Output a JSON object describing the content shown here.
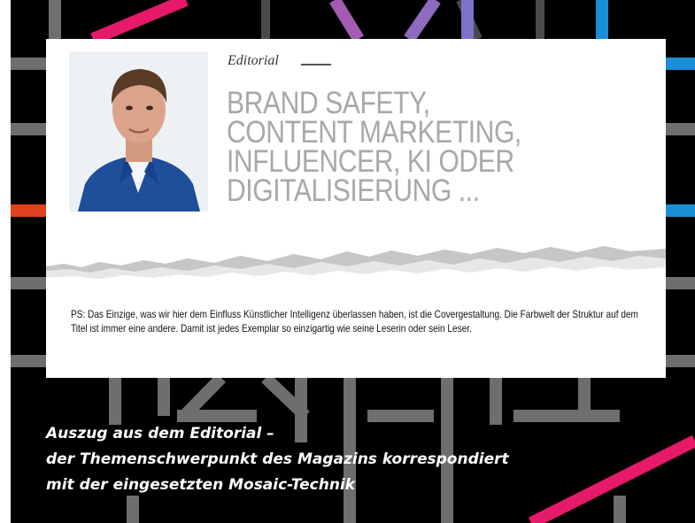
{
  "editorial": {
    "kicker": "Editorial",
    "headline_lines": [
      "BRAND SAFETY,",
      "CONTENT MARKETING,",
      "INFLUENCER, KI ODER",
      "DIGITALISIERUNG ..."
    ],
    "ps_text": "PS: Das Einzige, was wir hier dem Einfluss Künstlicher Intelligenz überlassen haben, ist die Covergestaltung. Die Farbwelt der Struktur auf dem Titel ist immer eine andere. Damit ist jedes Exemplar so einzigartig wie seine Leserin oder sein Leser."
  },
  "caption_lines": [
    "Auszug aus dem Editorial –",
    "der Themenschwerpunkt des Magazins korrespondiert",
    "mit der eingesetzten Mosaic-Technik"
  ],
  "colors": {
    "background": "#000000",
    "grid_gray": "#6e6e6e",
    "accent_magenta": "#e6196a",
    "accent_purple": "#a45bb2",
    "accent_violet": "#7c73c8",
    "accent_blue": "#1a8fd8",
    "accent_orange": "#e0401c",
    "headline_gray": "#a8a8a8"
  }
}
